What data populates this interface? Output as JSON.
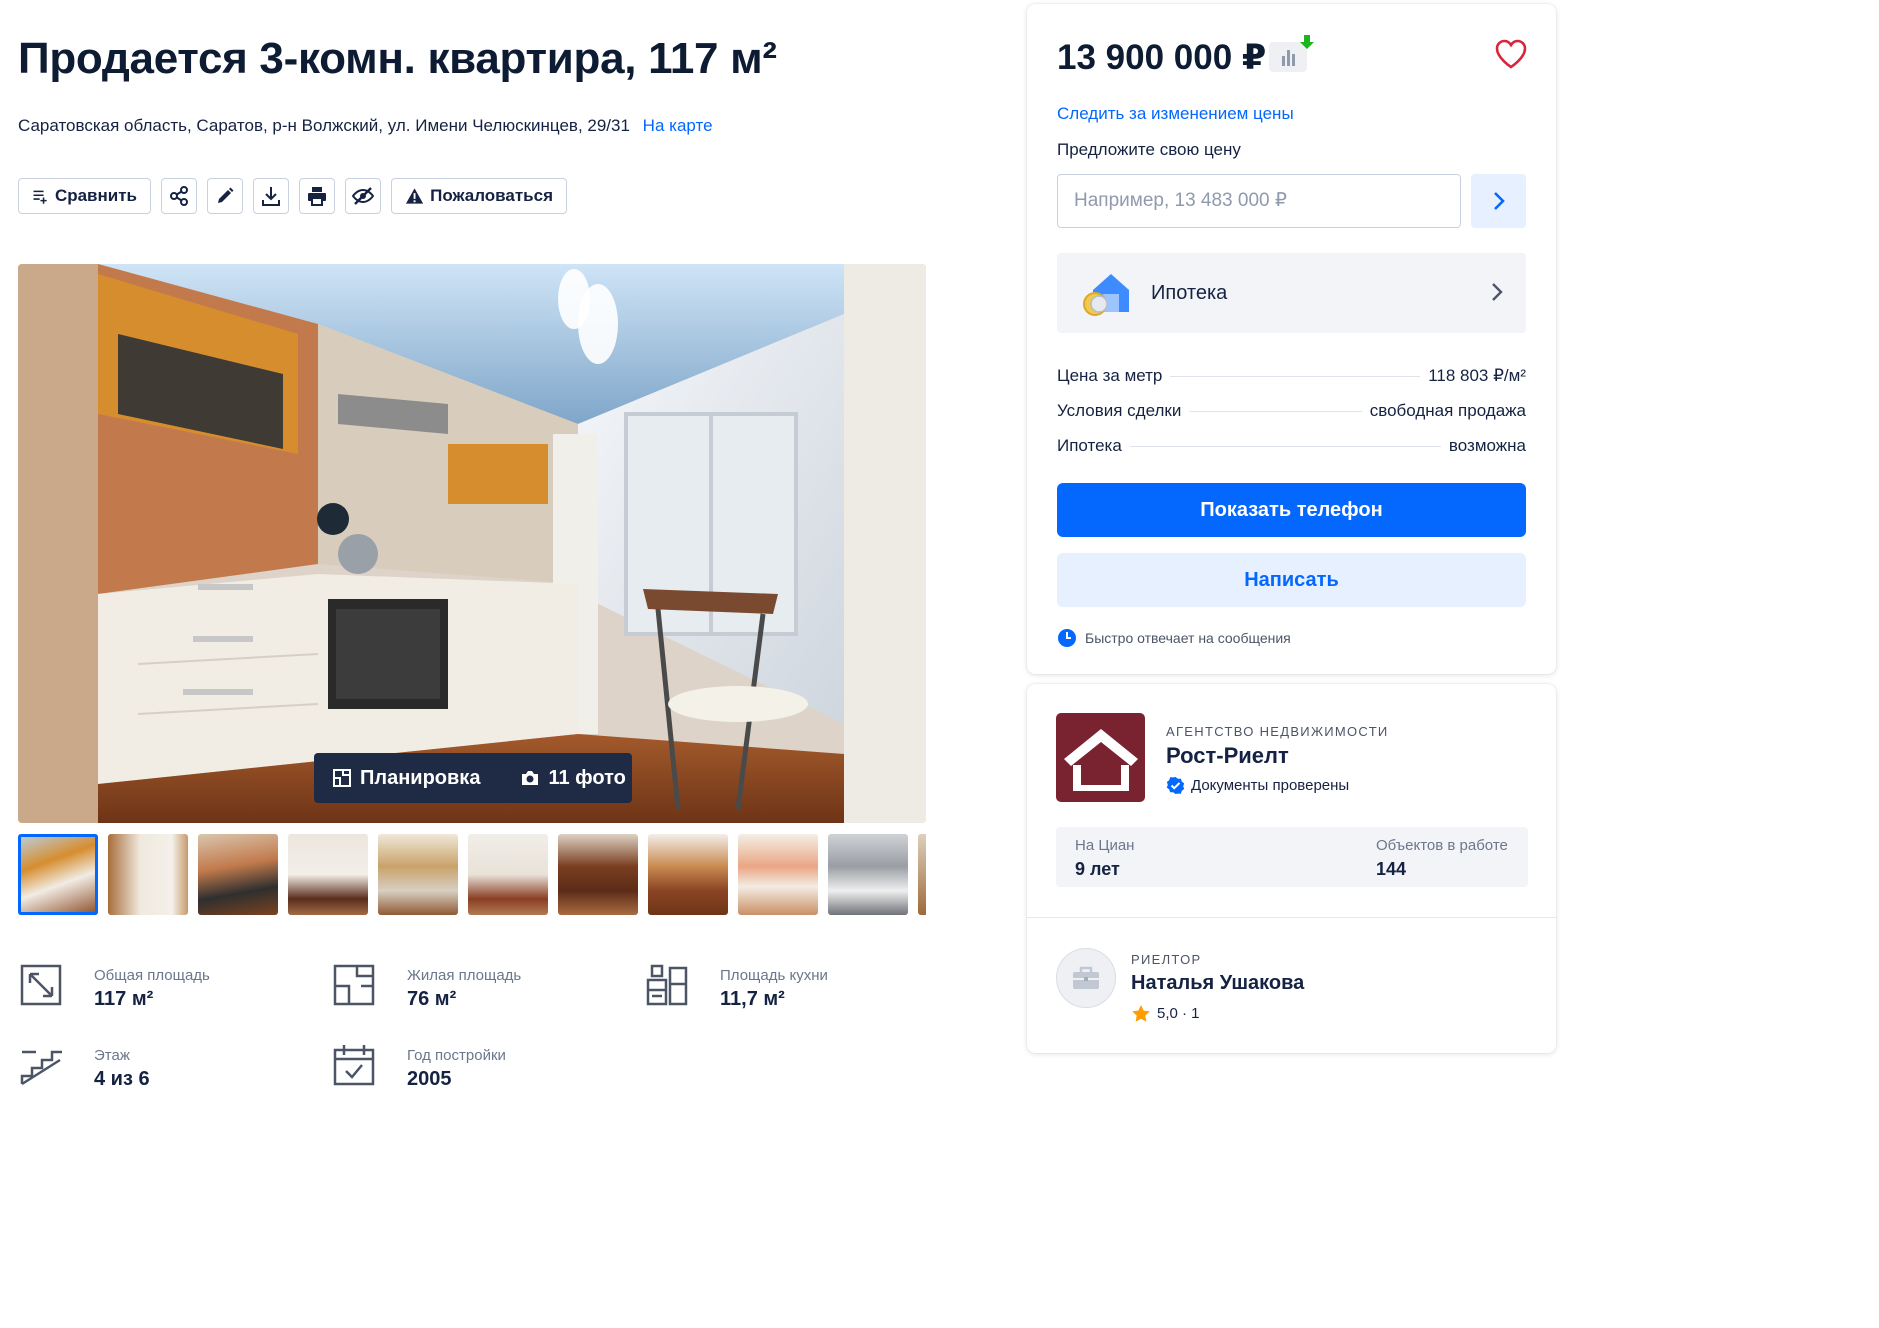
{
  "listing": {
    "title": "Продается 3-комн. квартира, 117 м²",
    "address": "Саратовская область, Саратов, р-н Волжский, ул. Имени Челюскинцев, 29/31",
    "map_link": "На карте"
  },
  "toolbar": {
    "compare_label": "Сравнить",
    "complain_label": "Пожаловаться",
    "icons": [
      "list-plus-icon",
      "share-icon",
      "pencil-icon",
      "download-icon",
      "printer-icon",
      "hide-eye-icon",
      "warning-icon"
    ]
  },
  "gallery": {
    "layout_label": "Планировка",
    "photos_label": "11 фото",
    "thumbnails_visible": 10
  },
  "facts": [
    {
      "label": "Общая площадь",
      "value": "117 м²",
      "icon": "area-arrow-icon"
    },
    {
      "label": "Жилая площадь",
      "value": "76 м²",
      "icon": "living-area-icon"
    },
    {
      "label": "Площадь кухни",
      "value": "11,7 м²",
      "icon": "kitchen-icon"
    },
    {
      "label": "Этаж",
      "value": "4 из 6",
      "icon": "stairs-icon"
    },
    {
      "label": "Год постройки",
      "value": "2005",
      "icon": "calendar-icon"
    }
  ],
  "price_card": {
    "price": "13 900 000 ₽",
    "watch_price": "Следить за изменением цены",
    "offer_label": "Предложите свою цену",
    "offer_placeholder": "Например, 13 483 000 ₽",
    "mortgage_label": "Ипотека",
    "details": [
      {
        "key": "Цена за метр",
        "value": "118 803 ₽/м²"
      },
      {
        "key": "Условия сделки",
        "value": "свободная продажа"
      },
      {
        "key": "Ипотека",
        "value": "возможна"
      }
    ],
    "show_phone": "Показать телефон",
    "write": "Написать",
    "fast_reply": "Быстро отвечает на сообщения"
  },
  "agency": {
    "type": "АГЕНТСТВО НЕДВИЖИМОСТИ",
    "name": "Рост-Риелт",
    "verified": "Документы проверены",
    "stats": [
      {
        "key": "На Циан",
        "value": "9 лет"
      },
      {
        "key": "Объектов в работе",
        "value": "144"
      }
    ]
  },
  "realtor": {
    "type": "РИЕЛТОР",
    "name": "Наталья Ушакова",
    "rating": "5,0 · 1"
  },
  "colors": {
    "accent": "#0468ff",
    "accent_light": "#e7f0ff",
    "text": "#152242",
    "agency_brand": "#7a2330",
    "rating_star": "#ff9d00"
  }
}
